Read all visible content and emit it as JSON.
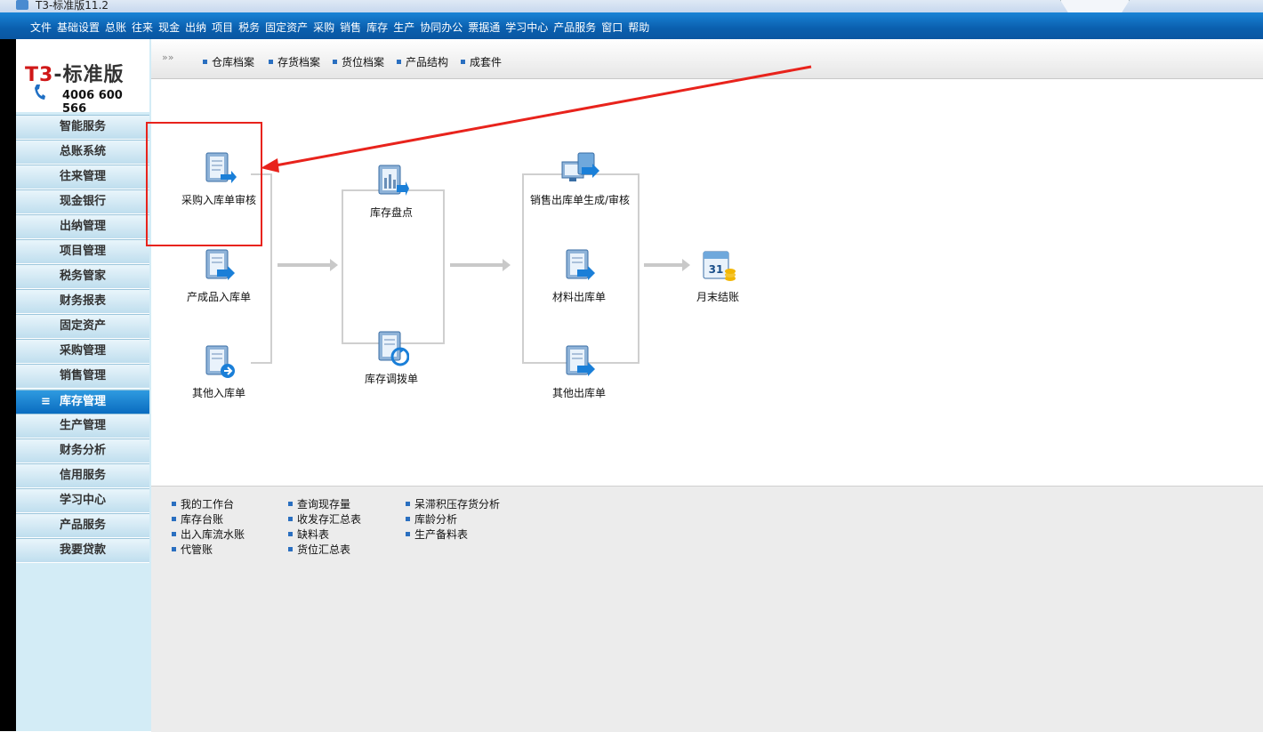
{
  "window": {
    "title": "T3-标准版11.2"
  },
  "menu": [
    "文件",
    "基础设置",
    "总账",
    "往来",
    "现金",
    "出纳",
    "项目",
    "税务",
    "固定资产",
    "采购",
    "销售",
    "库存",
    "生产",
    "协同办公",
    "票据通",
    "学习中心",
    "产品服务",
    "窗口",
    "帮助"
  ],
  "logo": {
    "brand_prefix": "T3",
    "brand_rest": "-标准版",
    "phone": "4006 600 566"
  },
  "sidebar": {
    "items": [
      "智能服务",
      "总账系统",
      "往来管理",
      "现金银行",
      "出纳管理",
      "项目管理",
      "税务管家",
      "财务报表",
      "固定资产",
      "采购管理",
      "销售管理",
      "库存管理",
      "生产管理",
      "财务分析",
      "信用服务",
      "学习中心",
      "产品服务",
      "我要贷款"
    ],
    "active": "库存管理",
    "active_marker": "≡"
  },
  "toolbar": {
    "arrows": "»»",
    "items": [
      "仓库档案",
      "存货档案",
      "货位档案",
      "产品结构",
      "成套件"
    ]
  },
  "flow": {
    "col1": [
      "采购入库单审核",
      "产成品入库单",
      "其他入库单"
    ],
    "col2": [
      "库存盘点",
      "库存调拨单"
    ],
    "col3": [
      "销售出库单生成/审核",
      "材料出库单",
      "其他出库单"
    ],
    "final": "月末结账",
    "calendar_day": "31"
  },
  "reports": {
    "col1": [
      "我的工作台",
      "库存台账",
      "出入库流水账",
      "代管账"
    ],
    "col2": [
      "查询现存量",
      "收发存汇总表",
      "缺料表",
      "货位汇总表"
    ],
    "col3": [
      "呆滞积压存货分析",
      "库龄分析",
      "生产备料表"
    ]
  },
  "colors": {
    "accent": "#0a5fae",
    "highlight": "#e8231c"
  }
}
